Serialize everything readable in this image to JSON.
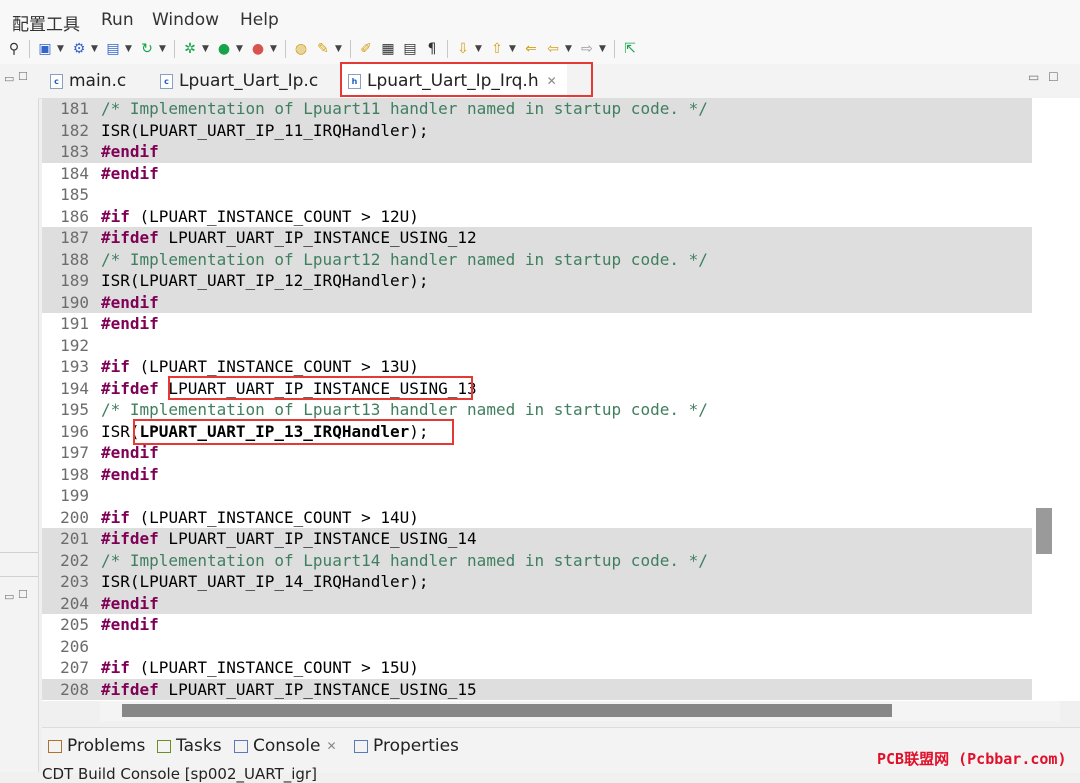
{
  "menu": [
    "配置工具",
    "Run",
    "Window",
    "Help"
  ],
  "tabs": [
    {
      "label": "main.c"
    },
    {
      "label": "Lpuart_Uart_Ip.c"
    },
    {
      "label": "Lpuart_Uart_Ip_Irq.h",
      "active": true
    }
  ],
  "code_lines": [
    {
      "n": "181",
      "hl": true,
      "tokens": [
        [
          "cm",
          "/* Implementation of Lpuart11 handler named in startup code. */"
        ]
      ]
    },
    {
      "n": "182",
      "hl": true,
      "tokens": [
        [
          "",
          "ISR(LPUART_UART_IP_11_IRQHandler);"
        ]
      ]
    },
    {
      "n": "183",
      "hl": true,
      "tokens": [
        [
          "kw",
          "#endif"
        ]
      ]
    },
    {
      "n": "184",
      "hl": false,
      "tokens": [
        [
          "kw",
          "#endif"
        ]
      ]
    },
    {
      "n": "185",
      "hl": false,
      "tokens": []
    },
    {
      "n": "186",
      "hl": false,
      "tokens": [
        [
          "kw",
          "#if"
        ],
        [
          "",
          " (LPUART_INSTANCE_COUNT > 12U)"
        ]
      ]
    },
    {
      "n": "187",
      "hl": true,
      "tokens": [
        [
          "kw",
          "#ifdef"
        ],
        [
          "",
          " LPUART_UART_IP_INSTANCE_USING_12"
        ]
      ]
    },
    {
      "n": "188",
      "hl": true,
      "tokens": [
        [
          "cm",
          "/* Implementation of Lpuart12 handler named in startup code. */"
        ]
      ]
    },
    {
      "n": "189",
      "hl": true,
      "tokens": [
        [
          "",
          "ISR(LPUART_UART_IP_12_IRQHandler);"
        ]
      ]
    },
    {
      "n": "190",
      "hl": true,
      "tokens": [
        [
          "kw",
          "#endif"
        ]
      ]
    },
    {
      "n": "191",
      "hl": false,
      "tokens": [
        [
          "kw",
          "#endif"
        ]
      ]
    },
    {
      "n": "192",
      "hl": false,
      "tokens": []
    },
    {
      "n": "193",
      "hl": false,
      "tokens": [
        [
          "kw",
          "#if"
        ],
        [
          "",
          " (LPUART_INSTANCE_COUNT > 13U)"
        ]
      ]
    },
    {
      "n": "194",
      "hl": false,
      "tokens": [
        [
          "kw",
          "#ifdef"
        ],
        [
          "",
          " LPUART_UART_IP_INSTANCE_USING_13"
        ]
      ]
    },
    {
      "n": "195",
      "hl": false,
      "tokens": [
        [
          "cm",
          "/* Implementation of Lpuart13 handler named in startup code. */"
        ]
      ]
    },
    {
      "n": "196",
      "hl": false,
      "tokens": [
        [
          "",
          "ISR("
        ],
        [
          "boldid",
          "LPUART_UART_IP_13_IRQHandler"
        ],
        [
          "",
          ");"
        ]
      ]
    },
    {
      "n": "197",
      "hl": false,
      "tokens": [
        [
          "kw",
          "#endif"
        ]
      ]
    },
    {
      "n": "198",
      "hl": false,
      "tokens": [
        [
          "kw",
          "#endif"
        ]
      ]
    },
    {
      "n": "199",
      "hl": false,
      "tokens": []
    },
    {
      "n": "200",
      "hl": false,
      "tokens": [
        [
          "kw",
          "#if"
        ],
        [
          "",
          " (LPUART_INSTANCE_COUNT > 14U)"
        ]
      ]
    },
    {
      "n": "201",
      "hl": true,
      "tokens": [
        [
          "kw",
          "#ifdef"
        ],
        [
          "",
          " LPUART_UART_IP_INSTANCE_USING_14"
        ]
      ]
    },
    {
      "n": "202",
      "hl": true,
      "tokens": [
        [
          "cm",
          "/* Implementation of Lpuart14 handler named in startup code. */"
        ]
      ]
    },
    {
      "n": "203",
      "hl": true,
      "tokens": [
        [
          "",
          "ISR(LPUART_UART_IP_14_IRQHandler);"
        ]
      ]
    },
    {
      "n": "204",
      "hl": true,
      "tokens": [
        [
          "kw",
          "#endif"
        ]
      ]
    },
    {
      "n": "205",
      "hl": false,
      "tokens": [
        [
          "kw",
          "#endif"
        ]
      ]
    },
    {
      "n": "206",
      "hl": false,
      "tokens": []
    },
    {
      "n": "207",
      "hl": false,
      "tokens": [
        [
          "kw",
          "#if"
        ],
        [
          "",
          " (LPUART_INSTANCE_COUNT > 15U)"
        ]
      ]
    },
    {
      "n": "208",
      "hl": true,
      "tokens": [
        [
          "kw",
          "#ifdef"
        ],
        [
          "",
          " LPUART_UART_IP_INSTANCE_USING_15"
        ]
      ]
    }
  ],
  "bottom_tabs": [
    "Problems",
    "Tasks",
    "Console",
    "Properties"
  ],
  "console_title": "CDT Build Console [sp002_UART_igr]",
  "watermark": "PCB联盟网 (Pcbbar.com)",
  "colors": {
    "keyword": "#7f0055",
    "comment": "#3f7f5f",
    "highlight": "#dedede",
    "annotation": "#e53935"
  }
}
